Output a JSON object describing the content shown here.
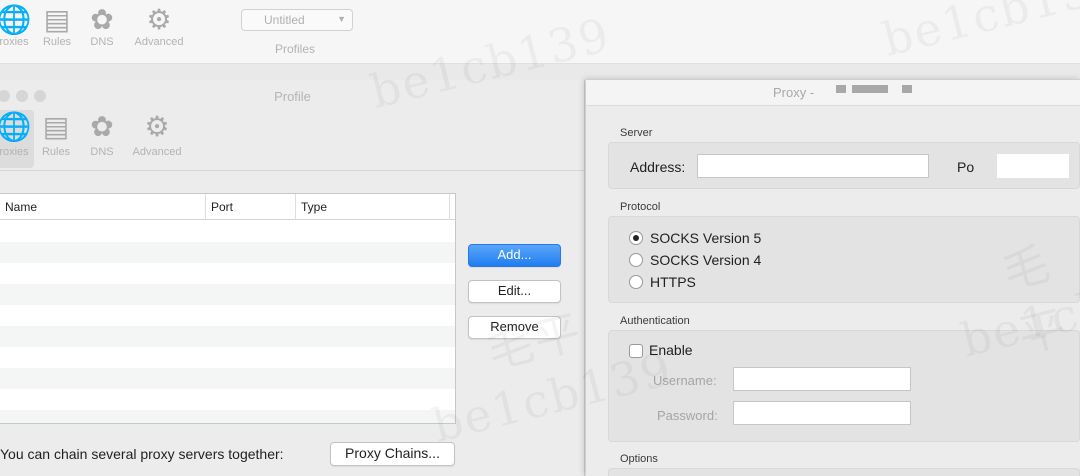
{
  "toolbar": {
    "items": [
      {
        "label": "roxies",
        "icon": "globe-icon"
      },
      {
        "label": "Rules",
        "icon": "list-icon"
      },
      {
        "label": "DNS",
        "icon": "dns-icon"
      },
      {
        "label": "Advanced",
        "icon": "gear-icon"
      }
    ],
    "profile_select": "Untitled",
    "profile_label": "Profiles"
  },
  "profile_window": {
    "title": "Profile",
    "toolbar_items": [
      {
        "label": "roxies",
        "icon": "globe-icon"
      },
      {
        "label": "Rules",
        "icon": "list-icon"
      },
      {
        "label": "DNS",
        "icon": "dns-icon"
      },
      {
        "label": "Advanced",
        "icon": "gear-icon"
      }
    ],
    "table_columns": [
      "Name",
      "Port",
      "Type"
    ],
    "buttons": {
      "add": "Add...",
      "edit": "Edit...",
      "remove": "Remove"
    },
    "chain_text": "You can chain several proxy servers together:",
    "chain_button": "Proxy Chains..."
  },
  "proxy_window": {
    "title": "Proxy -",
    "server_label": "Server",
    "address_label": "Address:",
    "port_label": "Po",
    "protocol_label": "Protocol",
    "protocols": [
      "SOCKS Version 5",
      "SOCKS Version 4",
      "HTTPS"
    ],
    "selected_protocol": "SOCKS Version 5",
    "auth_label": "Authentication",
    "enable_label": "Enable",
    "username_label": "Username:",
    "password_label": "Password:",
    "options_label": "Options"
  },
  "colors": {
    "accent": "#1f7df0"
  },
  "watermarks": [
    "be1cb139",
    "毛平",
    "be1cb139",
    "be1cb139",
    "毛平",
    "be1cb"
  ]
}
